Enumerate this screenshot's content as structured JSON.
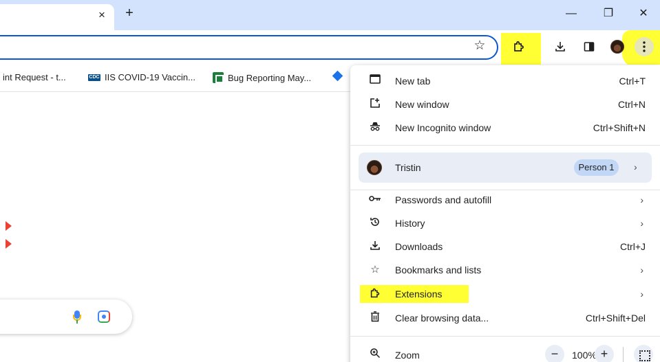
{
  "window": {
    "tab_close": "×",
    "new_tab": "+",
    "minimize": "—",
    "maximize": "❐",
    "close": "✕"
  },
  "toolbar": {
    "icons": [
      "bookmark-star-icon",
      "extensions-puzzle-icon",
      "download-icon",
      "side-panel-icon",
      "profile-avatar-icon",
      "menu-kebab-icon"
    ],
    "highlight_color": "#ffff33"
  },
  "bookmarks": [
    {
      "label": "int Request - t...",
      "icon": "none"
    },
    {
      "label": "IIS COVID-19 Vaccin...",
      "icon": "cdc-logo"
    },
    {
      "label": "Bug Reporting May...",
      "icon": "google-sheets-icon"
    },
    {
      "label": "",
      "icon": "blue-diamond-icon"
    }
  ],
  "menu": {
    "items_top": [
      {
        "label": "New tab",
        "shortcut": "Ctrl+T",
        "icon": "new-tab-icon"
      },
      {
        "label": "New window",
        "shortcut": "Ctrl+N",
        "icon": "new-window-icon"
      },
      {
        "label": "New Incognito window",
        "shortcut": "Ctrl+Shift+N",
        "icon": "incognito-icon"
      }
    ],
    "profile": {
      "name": "Tristin",
      "chip": "Person 1"
    },
    "items_mid": [
      {
        "label": "Passwords and autofill",
        "shortcut": "",
        "icon": "key-icon",
        "submenu": true
      },
      {
        "label": "History",
        "shortcut": "",
        "icon": "history-icon",
        "submenu": true
      },
      {
        "label": "Downloads",
        "shortcut": "Ctrl+J",
        "icon": "download-icon",
        "submenu": false
      },
      {
        "label": "Bookmarks and lists",
        "shortcut": "",
        "icon": "star-icon",
        "submenu": true
      },
      {
        "label": "Extensions",
        "shortcut": "",
        "icon": "extensions-puzzle-icon",
        "submenu": true
      },
      {
        "label": "Clear browsing data...",
        "shortcut": "Ctrl+Shift+Del",
        "icon": "trash-icon",
        "submenu": false
      }
    ],
    "zoom": {
      "label": "Zoom",
      "minus": "−",
      "value": "100%",
      "plus": "+"
    }
  }
}
